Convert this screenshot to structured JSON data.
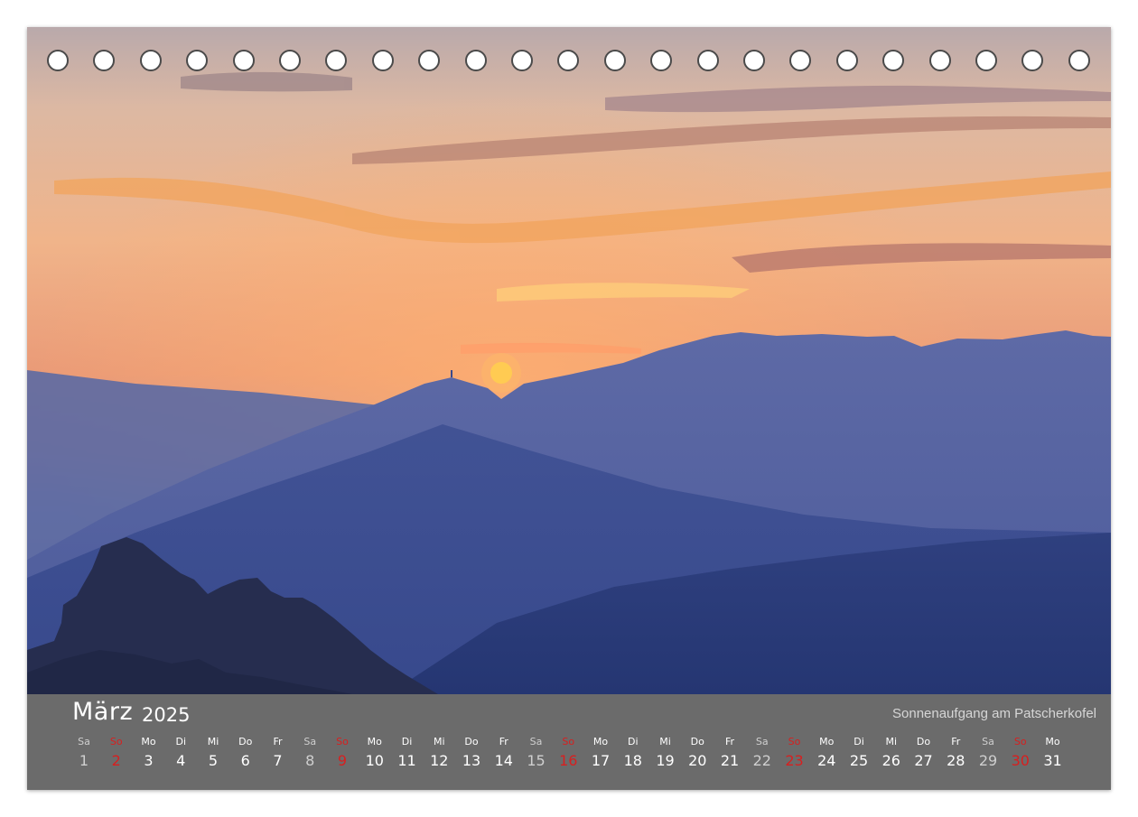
{
  "calendar": {
    "month": "März",
    "year": "2025",
    "caption": "Sonnenaufgang am Patscherkofel",
    "days": [
      {
        "wd": "Sa",
        "num": "1",
        "type": "sat"
      },
      {
        "wd": "So",
        "num": "2",
        "type": "sun"
      },
      {
        "wd": "Mo",
        "num": "3",
        "type": "week"
      },
      {
        "wd": "Di",
        "num": "4",
        "type": "week"
      },
      {
        "wd": "Mi",
        "num": "5",
        "type": "week"
      },
      {
        "wd": "Do",
        "num": "6",
        "type": "week"
      },
      {
        "wd": "Fr",
        "num": "7",
        "type": "week"
      },
      {
        "wd": "Sa",
        "num": "8",
        "type": "sat"
      },
      {
        "wd": "So",
        "num": "9",
        "type": "sun"
      },
      {
        "wd": "Mo",
        "num": "10",
        "type": "week"
      },
      {
        "wd": "Di",
        "num": "11",
        "type": "week"
      },
      {
        "wd": "Mi",
        "num": "12",
        "type": "week"
      },
      {
        "wd": "Do",
        "num": "13",
        "type": "week"
      },
      {
        "wd": "Fr",
        "num": "14",
        "type": "week"
      },
      {
        "wd": "Sa",
        "num": "15",
        "type": "sat"
      },
      {
        "wd": "So",
        "num": "16",
        "type": "sun"
      },
      {
        "wd": "Mo",
        "num": "17",
        "type": "week"
      },
      {
        "wd": "Di",
        "num": "18",
        "type": "week"
      },
      {
        "wd": "Mi",
        "num": "19",
        "type": "week"
      },
      {
        "wd": "Do",
        "num": "20",
        "type": "week"
      },
      {
        "wd": "Fr",
        "num": "21",
        "type": "week"
      },
      {
        "wd": "Sa",
        "num": "22",
        "type": "sat"
      },
      {
        "wd": "So",
        "num": "23",
        "type": "sun"
      },
      {
        "wd": "Mo",
        "num": "24",
        "type": "week"
      },
      {
        "wd": "Di",
        "num": "25",
        "type": "week"
      },
      {
        "wd": "Mi",
        "num": "26",
        "type": "week"
      },
      {
        "wd": "Do",
        "num": "27",
        "type": "week"
      },
      {
        "wd": "Fr",
        "num": "28",
        "type": "week"
      },
      {
        "wd": "Sa",
        "num": "29",
        "type": "sat"
      },
      {
        "wd": "So",
        "num": "30",
        "type": "sun"
      },
      {
        "wd": "Mo",
        "num": "31",
        "type": "week"
      }
    ]
  },
  "colors": {
    "bar_background": "#6b6b6b",
    "sunday": "#d81f1f",
    "saturday": "#cfcfcf",
    "weekday": "#ffffff"
  }
}
